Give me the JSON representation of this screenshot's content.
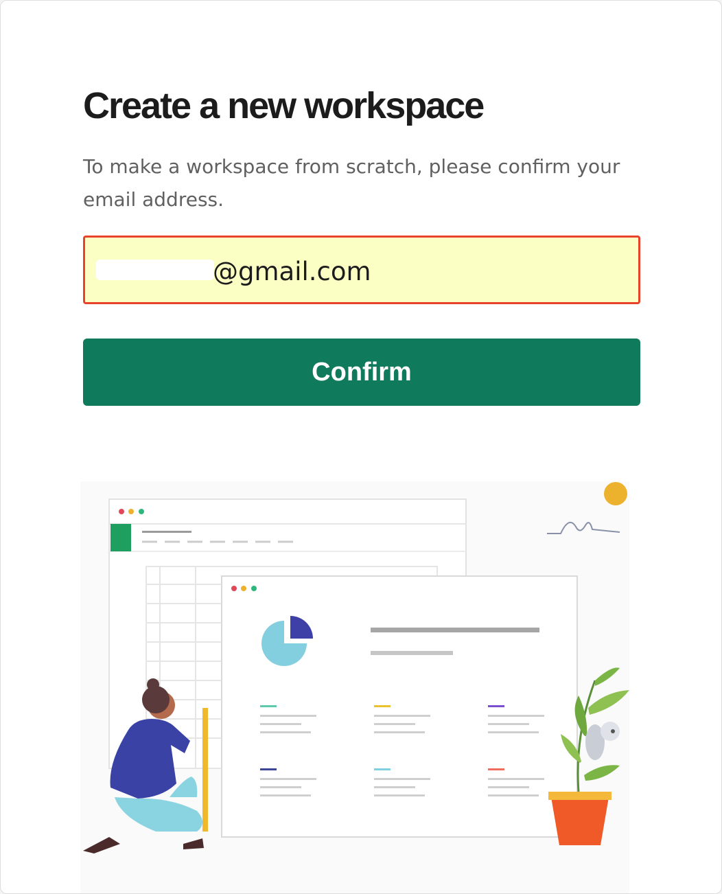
{
  "page": {
    "title": "Create a new workspace",
    "subtitle": "To make a workspace from scratch, please confirm your email address."
  },
  "email_field": {
    "value": "@gmail.com",
    "value_redacted": true
  },
  "confirm_button": {
    "label": "Confirm"
  },
  "colors": {
    "button_bg": "#107a5c",
    "field_bg": "#fbffc4",
    "field_border": "#e8412c",
    "title_text": "#1d1c1d",
    "body_text": "#616061"
  },
  "illustration": {
    "name": "workspace-illustration"
  }
}
